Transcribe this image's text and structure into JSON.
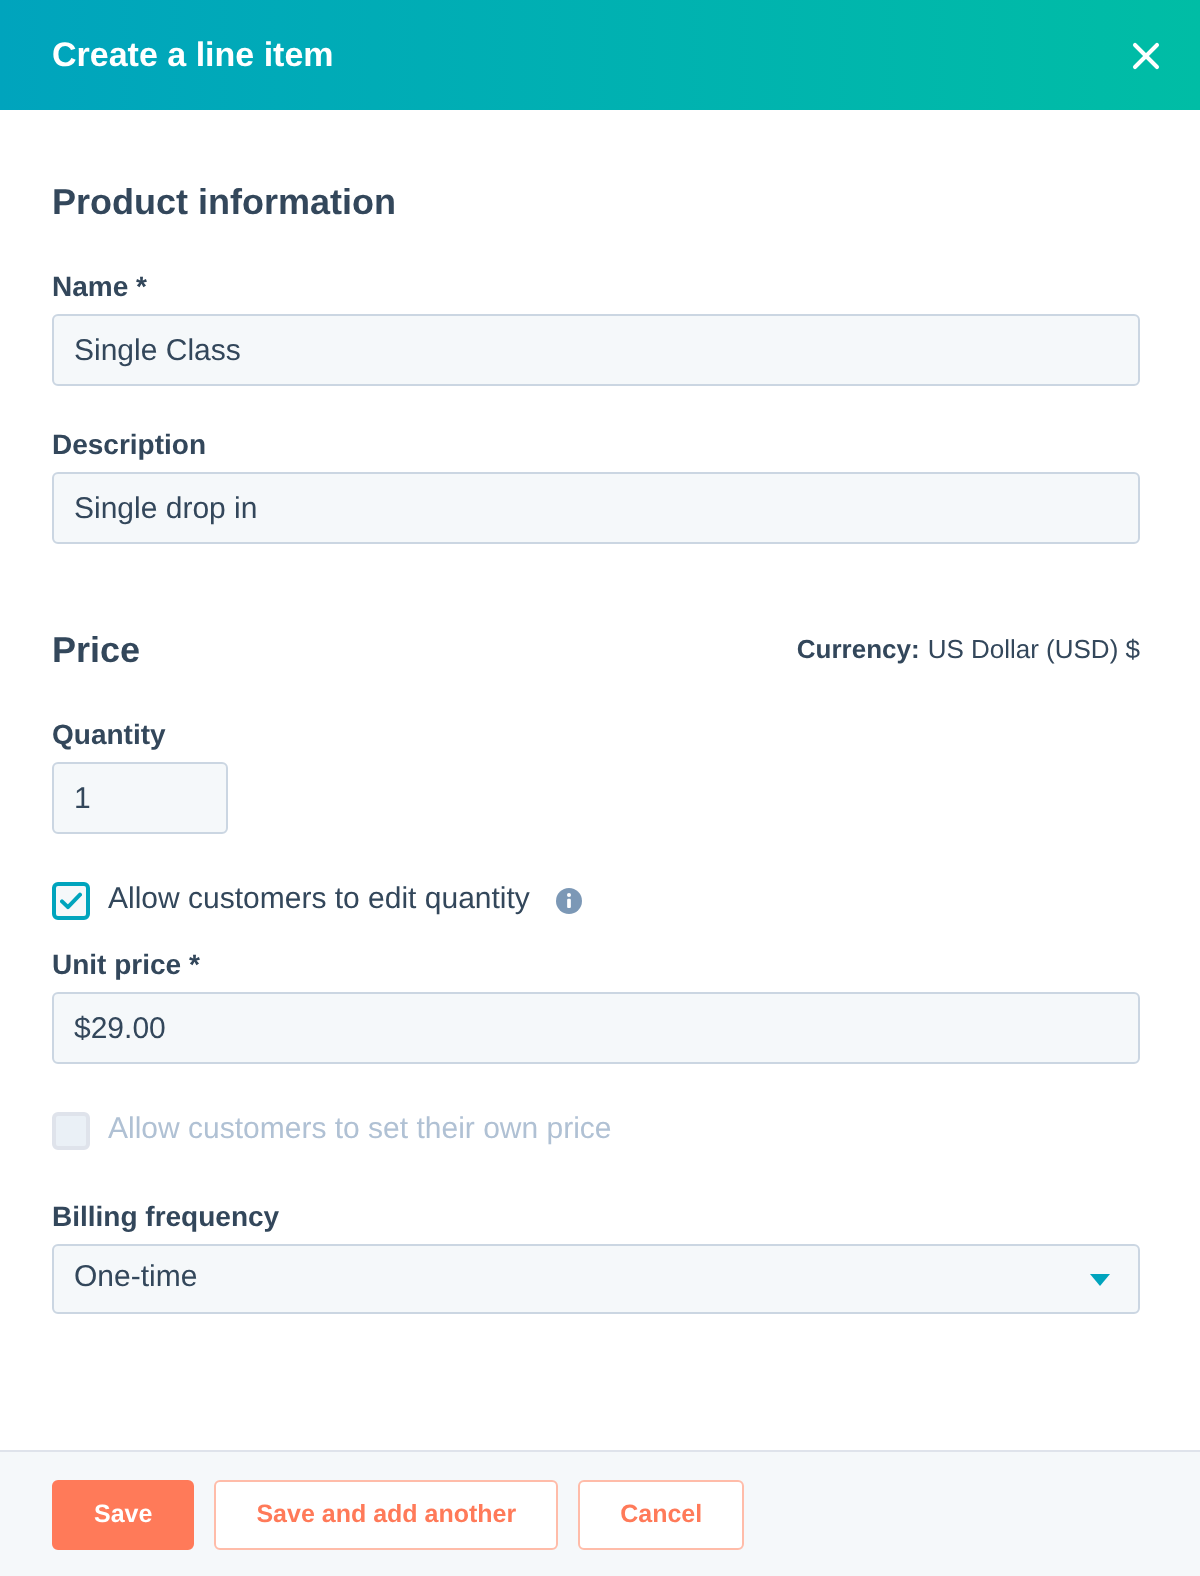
{
  "dialog": {
    "title": "Create a line item"
  },
  "product_information": {
    "heading": "Product information",
    "fields": [
      {
        "label": "Name *",
        "value": "Single Class"
      },
      {
        "label": "Description",
        "value": "Single drop in"
      }
    ]
  },
  "price": {
    "heading": "Price",
    "currency": {
      "label": "Currency:",
      "value": "US Dollar (USD) $"
    },
    "items": [
      {
        "kind": "number",
        "label": "Quantity",
        "value": "1"
      },
      {
        "kind": "checkbox",
        "label": "Allow customers to edit quantity",
        "checked": true,
        "disabled": false,
        "info": true
      },
      {
        "kind": "text",
        "label": "Unit price *",
        "value": "$29.00"
      },
      {
        "kind": "checkbox",
        "label": "Allow customers to set their own price",
        "checked": false,
        "disabled": true,
        "info": false
      },
      {
        "kind": "select",
        "label": "Billing frequency",
        "value": "One-time"
      }
    ]
  },
  "footer": {
    "buttons": [
      {
        "kind": "primary",
        "label": "Save"
      },
      {
        "kind": "secondary",
        "label": "Save and add another"
      },
      {
        "kind": "secondary",
        "label": "Cancel"
      }
    ]
  }
}
